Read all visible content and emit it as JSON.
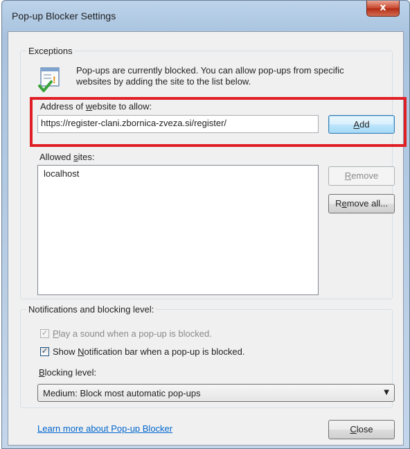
{
  "window": {
    "title": "Pop-up Blocker Settings",
    "close_glyph": "x"
  },
  "exceptions": {
    "group_label": "Exceptions",
    "info_text": "Pop-ups are currently blocked.  You can allow pop-ups from specific websites by adding the site to the list below.",
    "address_label_pre": "Address of ",
    "address_label_ul": "w",
    "address_label_post": "ebsite to allow:",
    "address_value": "https://register-clani.zbornica-zveza.si/register/",
    "add_button_ul": "A",
    "add_button_rest": "dd",
    "allowed_label_pre": "Allowed ",
    "allowed_label_ul": "s",
    "allowed_label_post": "ites:",
    "allowed_sites": [
      "localhost"
    ],
    "remove_button_ul": "R",
    "remove_button_rest": "emove",
    "remove_all_pre": "R",
    "remove_all_ul": "e",
    "remove_all_post": "move all..."
  },
  "notifications": {
    "group_label": "Notifications and blocking level:",
    "play_sound_ul": "P",
    "play_sound_rest": "lay a sound when a pop-up is blocked.",
    "play_sound_checked": true,
    "play_sound_enabled": false,
    "show_bar_pre": "Show ",
    "show_bar_ul": "N",
    "show_bar_post": "otification bar when a pop-up is blocked.",
    "show_bar_checked": true,
    "blocking_label_ul": "B",
    "blocking_label_rest": "locking level:",
    "blocking_level_selected": "Medium: Block most automatic pop-ups",
    "dropdown_glyph": "▼"
  },
  "footer": {
    "learn_more": "Learn more about Pop-up Blocker",
    "close_ul": "C",
    "close_rest": "lose"
  },
  "colors": {
    "highlight": "#e01e26",
    "link": "#0066cc"
  }
}
